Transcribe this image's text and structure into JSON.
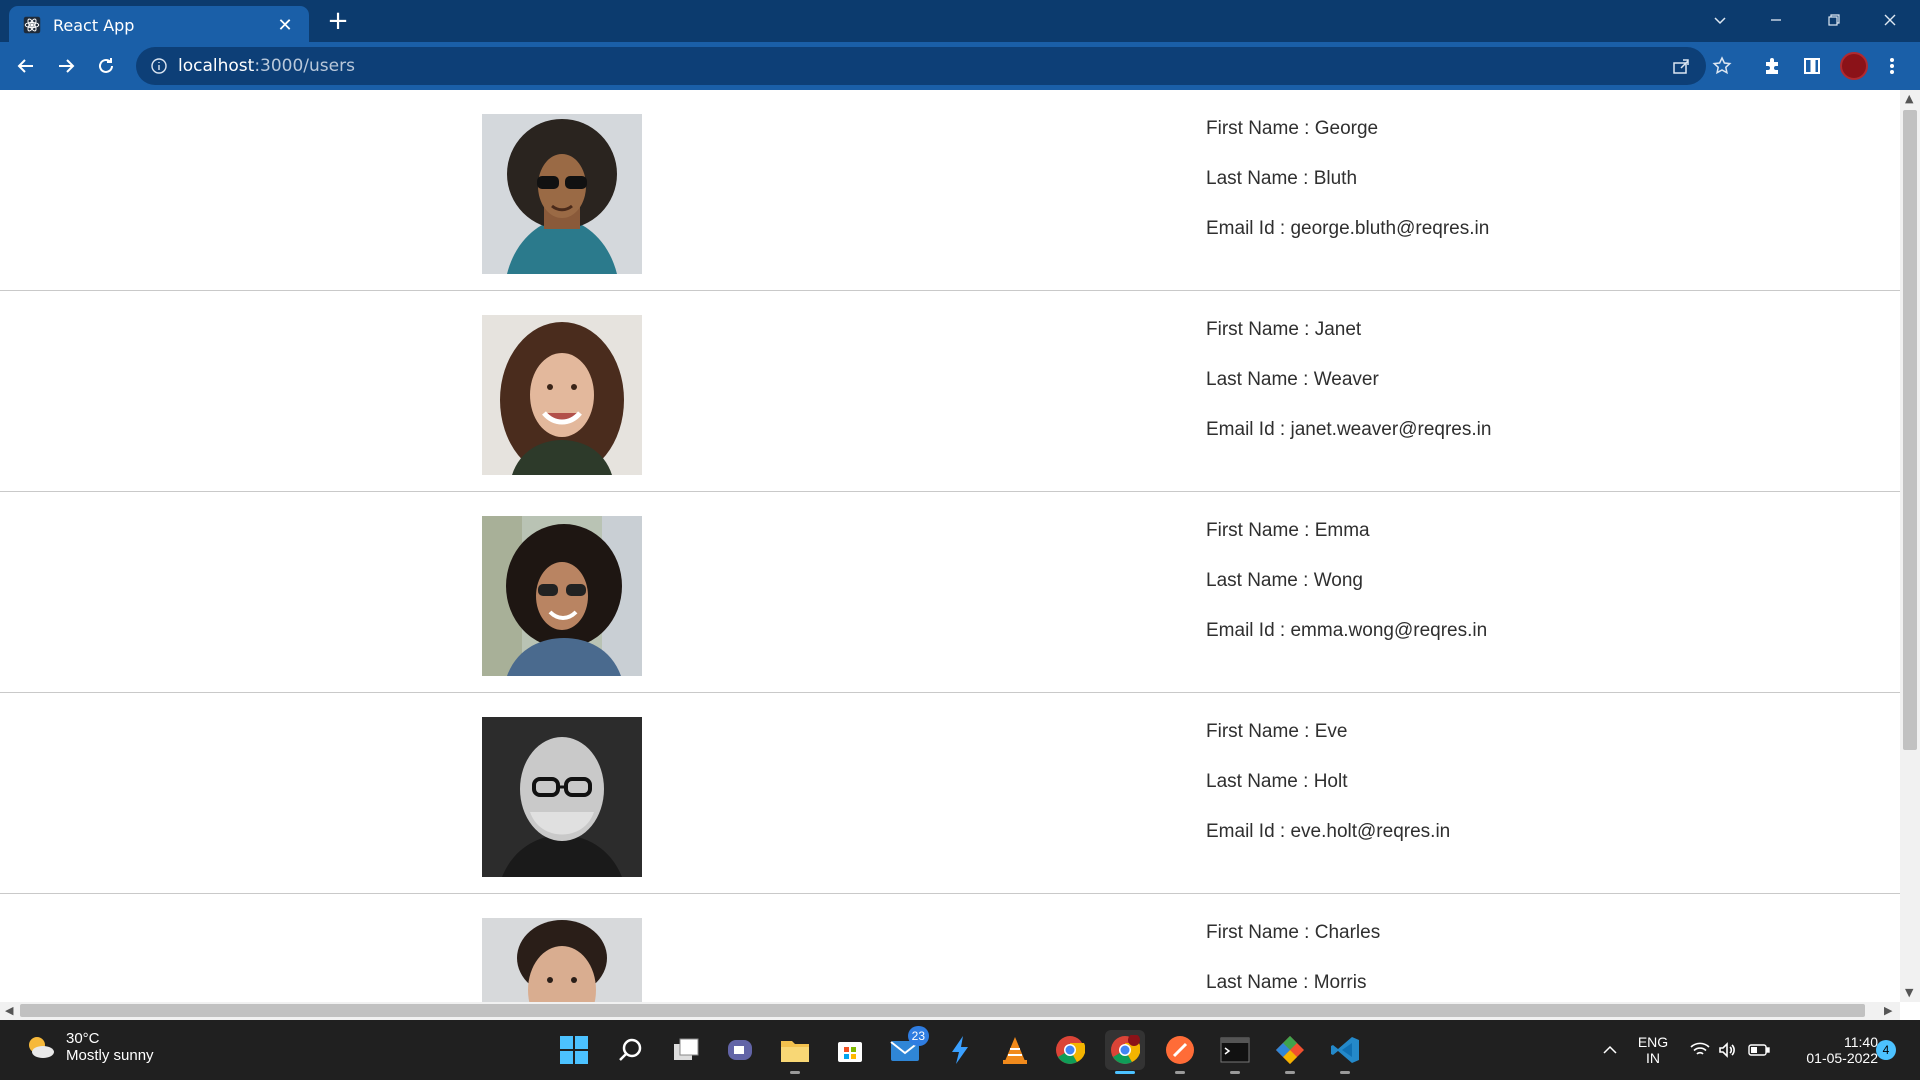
{
  "browser": {
    "tab_title": "React App",
    "new_tab": "+",
    "url_host": "localhost",
    "url_rest": ":3000/users"
  },
  "users": [
    {
      "first_name": "First Name : George",
      "last_name": "Last Name : Bluth",
      "email": "Email Id : george.bluth@reqres.in",
      "photo": "man-curly-hair-sunglasses-photo"
    },
    {
      "first_name": "First Name : Janet",
      "last_name": "Last Name : Weaver",
      "email": "Email Id : janet.weaver@reqres.in",
      "photo": "woman-smiling-wavy-hair-photo"
    },
    {
      "first_name": "First Name : Emma",
      "last_name": "Last Name : Wong",
      "email": "Email Id : emma.wong@reqres.in",
      "photo": "woman-curly-hair-sunglasses-photo"
    },
    {
      "first_name": "First Name : Eve",
      "last_name": "Last Name : Holt",
      "email": "Email Id : eve.holt@reqres.in",
      "photo": "bald-man-glasses-bw-photo"
    },
    {
      "first_name": "First Name : Charles",
      "last_name": "Last Name : Morris",
      "email": "",
      "photo": "man-dark-hair-photo"
    }
  ],
  "taskbar": {
    "temperature": "30°C",
    "weather": "Mostly sunny",
    "mail_badge": "23",
    "language": "ENG",
    "region": "IN",
    "time": "11:40",
    "date": "01-05-2022",
    "notification_count": "4"
  },
  "colors": {
    "tabbar": "#0c3b6e",
    "toolbar": "#1a5fa8",
    "taskbar": "#202020",
    "accent": "#4cc2ff"
  }
}
